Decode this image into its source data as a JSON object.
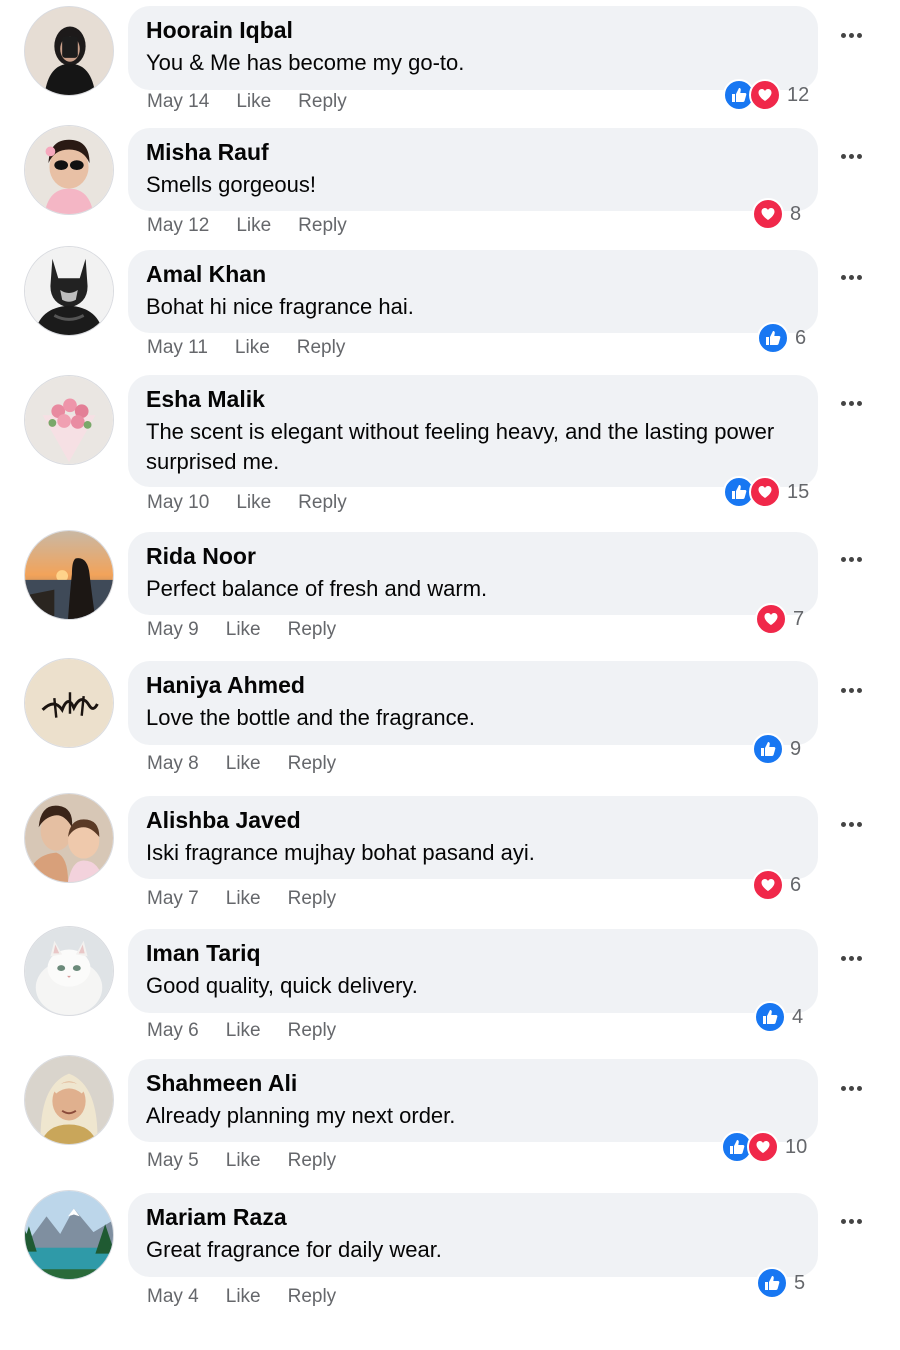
{
  "comments": [
    {
      "name": "Hoorain Iqbal",
      "text": "You & Me has become my go-to.",
      "date": "May 14",
      "like": "Like",
      "reply": "Reply",
      "reactions": [
        "like",
        "love"
      ],
      "count": "12",
      "avatar": "portrait-avatar"
    },
    {
      "name": "Misha Rauf",
      "text": "Smells gorgeous!",
      "date": "May 12",
      "like": "Like",
      "reply": "Reply",
      "reactions": [
        "love"
      ],
      "count": "8",
      "avatar": "child-avatar"
    },
    {
      "name": "Amal Khan",
      "text": "Bohat hi nice fragrance hai.",
      "date": "May 11",
      "like": "Like",
      "reply": "Reply",
      "reactions": [
        "like"
      ],
      "count": "6",
      "avatar": "batman-avatar"
    },
    {
      "name": "Esha Malik",
      "text": "The scent is elegant without feeling heavy, and the lasting power surprised me.",
      "date": "May 10",
      "like": "Like",
      "reply": "Reply",
      "reactions": [
        "like",
        "love"
      ],
      "count": "15",
      "avatar": "flowers-avatar"
    },
    {
      "name": "Rida Noor",
      "text": "Perfect balance of fresh and warm.",
      "date": "May 9",
      "like": "Like",
      "reply": "Reply",
      "reactions": [
        "love"
      ],
      "count": "7",
      "avatar": "sunset-avatar"
    },
    {
      "name": "Haniya Ahmed",
      "text": "Love the bottle and the fragrance.",
      "date": "May 8",
      "like": "Like",
      "reply": "Reply",
      "reactions": [
        "like"
      ],
      "count": "9",
      "avatar": "calligraphy-avatar"
    },
    {
      "name": "Alishba Javed",
      "text": "Iski fragrance mujhay bohat pasand ayi.",
      "date": "May 7",
      "like": "Like",
      "reply": "Reply",
      "reactions": [
        "love"
      ],
      "count": "6",
      "avatar": "mother-child-avatar"
    },
    {
      "name": "Iman Tariq",
      "text": "Good quality, quick delivery.",
      "date": "May 6",
      "like": "Like",
      "reply": "Reply",
      "reactions": [
        "like"
      ],
      "count": "4",
      "avatar": "cat-avatar"
    },
    {
      "name": "Shahmeen Ali",
      "text": "Already planning my next order.",
      "date": "May 5",
      "like": "Like",
      "reply": "Reply",
      "reactions": [
        "like",
        "love"
      ],
      "count": "10",
      "avatar": "woman-avatar"
    },
    {
      "name": "Mariam Raza",
      "text": "Great fragrance for daily wear.",
      "date": "May 4",
      "like": "Like",
      "reply": "Reply",
      "reactions": [
        "like"
      ],
      "count": "5",
      "avatar": "mountain-lake-avatar"
    }
  ],
  "colors": {
    "like": "#1877f2",
    "love": "#f0284a",
    "bubble": "#f0f2f5",
    "meta": "#65676b"
  }
}
